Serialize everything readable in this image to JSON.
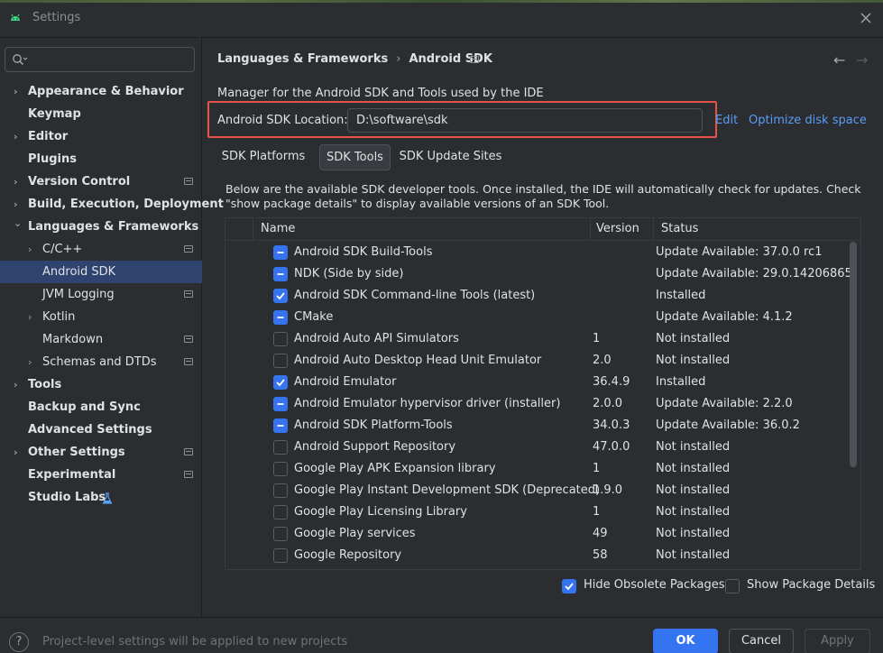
{
  "window": {
    "title": "Settings"
  },
  "colors": {
    "accent": "#3574f0",
    "selection": "#2e436e",
    "link": "#589df6",
    "highlight_box": "#e5534b"
  },
  "search": {
    "placeholder": ""
  },
  "sidebar": {
    "items": [
      {
        "label": "Appearance & Behavior",
        "bold": true,
        "chevron": "right",
        "indent": 0
      },
      {
        "label": "Keymap",
        "bold": true,
        "chevron": "",
        "indent": 0
      },
      {
        "label": "Editor",
        "bold": true,
        "chevron": "right",
        "indent": 0
      },
      {
        "label": "Plugins",
        "bold": true,
        "chevron": "",
        "indent": 0
      },
      {
        "label": "Version Control",
        "bold": true,
        "chevron": "right",
        "indent": 0,
        "project_icon": true
      },
      {
        "label": "Build, Execution, Deployment",
        "bold": true,
        "chevron": "right",
        "indent": 0
      },
      {
        "label": "Languages & Frameworks",
        "bold": true,
        "chevron": "down",
        "indent": 0
      },
      {
        "label": "C/C++",
        "bold": false,
        "chevron": "right",
        "indent": 1,
        "project_icon": true
      },
      {
        "label": "Android SDK",
        "bold": false,
        "chevron": "",
        "indent": 1,
        "selected": true
      },
      {
        "label": "JVM Logging",
        "bold": false,
        "chevron": "",
        "indent": 1,
        "project_icon": true
      },
      {
        "label": "Kotlin",
        "bold": false,
        "chevron": "right",
        "indent": 1
      },
      {
        "label": "Markdown",
        "bold": false,
        "chevron": "",
        "indent": 1,
        "project_icon": true
      },
      {
        "label": "Schemas and DTDs",
        "bold": false,
        "chevron": "right",
        "indent": 1,
        "project_icon": true
      },
      {
        "label": "Tools",
        "bold": true,
        "chevron": "right",
        "indent": 0
      },
      {
        "label": "Backup and Sync",
        "bold": true,
        "chevron": "",
        "indent": 0
      },
      {
        "label": "Advanced Settings",
        "bold": true,
        "chevron": "",
        "indent": 0
      },
      {
        "label": "Other Settings",
        "bold": true,
        "chevron": "right",
        "indent": 0,
        "project_icon": true
      },
      {
        "label": "Experimental",
        "bold": true,
        "chevron": "",
        "indent": 0,
        "project_icon": true
      },
      {
        "label": "Studio Labs",
        "bold": true,
        "chevron": "",
        "indent": 0,
        "flask_icon": true
      }
    ]
  },
  "main": {
    "breadcrumb": {
      "parent": "Languages & Frameworks",
      "separator": "›",
      "current": "Android SDK"
    },
    "description": "Manager for the Android SDK and Tools used by the IDE",
    "sdk_location": {
      "label": "Android SDK Location:",
      "value": "D:\\software\\sdk",
      "edit": "Edit",
      "optimize": "Optimize disk space"
    },
    "tabs": [
      {
        "label": "SDK Platforms",
        "active": false
      },
      {
        "label": "SDK Tools",
        "active": true
      },
      {
        "label": "SDK Update Sites",
        "active": false
      }
    ],
    "info_text": "Below are the available SDK developer tools. Once installed, the IDE will automatically check for updates. Check \"show package details\" to display available versions of an SDK Tool.",
    "table": {
      "columns": [
        "Name",
        "Version",
        "Status"
      ],
      "rows": [
        {
          "state": "partial",
          "name": "Android SDK Build-Tools",
          "version": "",
          "status": "Update Available: 37.0.0 rc1"
        },
        {
          "state": "partial",
          "name": "NDK (Side by side)",
          "version": "",
          "status": "Update Available: 29.0.14206865"
        },
        {
          "state": "checked",
          "name": "Android SDK Command-line Tools (latest)",
          "version": "",
          "status": "Installed"
        },
        {
          "state": "partial",
          "name": "CMake",
          "version": "",
          "status": "Update Available: 4.1.2"
        },
        {
          "state": "unchecked",
          "name": "Android Auto API Simulators",
          "version": "1",
          "status": "Not installed"
        },
        {
          "state": "unchecked",
          "name": "Android Auto Desktop Head Unit Emulator",
          "version": "2.0",
          "status": "Not installed"
        },
        {
          "state": "checked",
          "name": "Android Emulator",
          "version": "36.4.9",
          "status": "Installed"
        },
        {
          "state": "partial",
          "name": "Android Emulator hypervisor driver (installer)",
          "version": "2.0.0",
          "status": "Update Available: 2.2.0"
        },
        {
          "state": "partial",
          "name": "Android SDK Platform-Tools",
          "version": "34.0.3",
          "status": "Update Available: 36.0.2"
        },
        {
          "state": "unchecked",
          "name": "Android Support Repository",
          "version": "47.0.0",
          "status": "Not installed"
        },
        {
          "state": "unchecked",
          "name": "Google Play APK Expansion library",
          "version": "1",
          "status": "Not installed"
        },
        {
          "state": "unchecked",
          "name": "Google Play Instant Development SDK (Deprecated)",
          "version": "1.9.0",
          "status": "Not installed"
        },
        {
          "state": "unchecked",
          "name": "Google Play Licensing Library",
          "version": "1",
          "status": "Not installed"
        },
        {
          "state": "unchecked",
          "name": "Google Play services",
          "version": "49",
          "status": "Not installed"
        },
        {
          "state": "unchecked",
          "name": "Google Repository",
          "version": "58",
          "status": "Not installed"
        },
        {
          "state": "partial",
          "name": "",
          "version": "",
          "status": ""
        }
      ]
    },
    "options": {
      "hide_obsolete": {
        "label": "Hide Obsolete Packages",
        "checked": true
      },
      "show_details": {
        "label": "Show Package Details",
        "checked": false
      }
    }
  },
  "footer": {
    "help": "?",
    "note": "Project-level settings will be applied to new projects",
    "ok": "OK",
    "cancel": "Cancel",
    "apply": "Apply"
  }
}
